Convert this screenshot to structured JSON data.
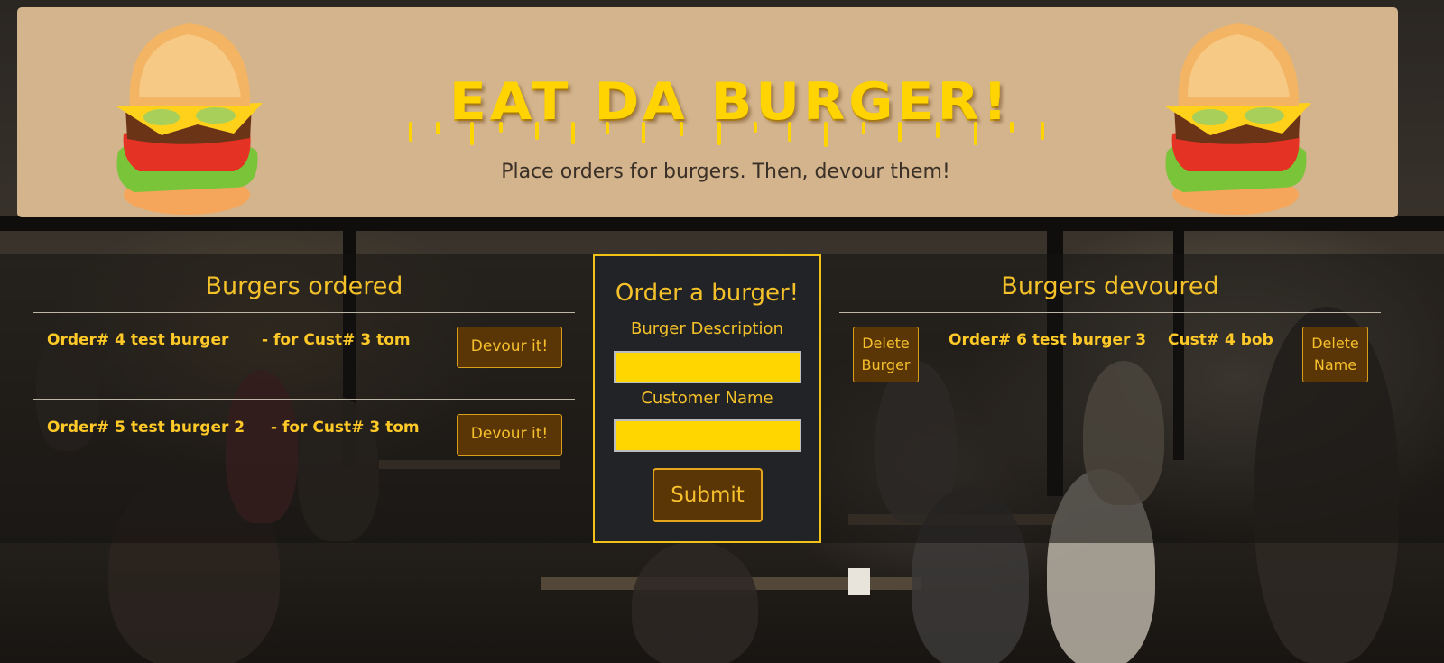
{
  "header": {
    "title": "EAT DA BURGER!",
    "tagline": "Place orders for burgers. Then, devour them!"
  },
  "ordered": {
    "heading": "Burgers ordered",
    "items": [
      {
        "order": "Order# 4 test burger",
        "customer": "- for Cust# 3 tom",
        "button": "Devour it!"
      },
      {
        "order": "Order# 5 test burger 2",
        "customer": "- for Cust# 3 tom",
        "button": "Devour it!"
      }
    ]
  },
  "form": {
    "title": "Order a burger!",
    "burger_label": "Burger Description",
    "burger_value": "",
    "customer_label": "Customer Name",
    "customer_value": "",
    "submit": "Submit"
  },
  "devoured": {
    "heading": "Burgers devoured",
    "items": [
      {
        "delete_burger": "Delete Burger",
        "order": "Order# 6 test burger 3",
        "customer": "Cust# 4 bob",
        "delete_name": "Delete Name"
      }
    ]
  },
  "colors": {
    "accent": "#f4c12a",
    "button_bg": "#5a3506",
    "jumbotron_bg": "#d3b48c",
    "input_bg": "#ffd600"
  },
  "icons": [
    "burger-icon",
    "burger-icon"
  ]
}
